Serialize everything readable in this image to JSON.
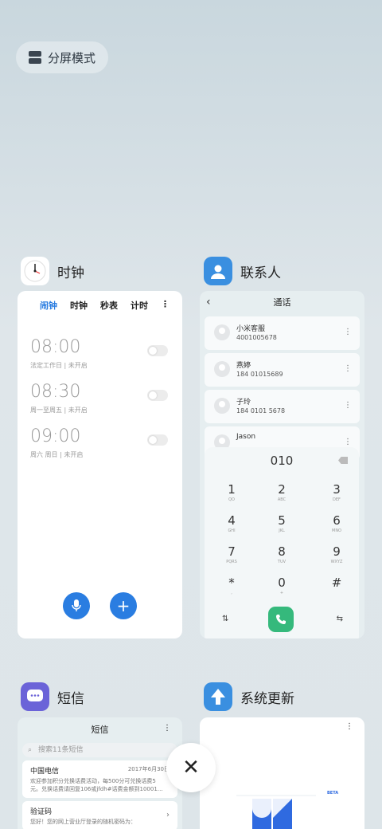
{
  "split_screen": {
    "label": "分屏模式"
  },
  "apps": {
    "clock": {
      "name": "时钟",
      "tabs": [
        "闹钟",
        "时钟",
        "秒表",
        "计时"
      ],
      "alarms": [
        {
          "time": "08:00",
          "desc": "法定工作日 | 未开启"
        },
        {
          "time": "08:30",
          "desc": "周一至周五 | 未开启"
        },
        {
          "time": "09:00",
          "desc": "周六 周日 | 未开启"
        }
      ]
    },
    "contacts": {
      "name": "联系人",
      "title": "通话",
      "list": [
        {
          "name": "小米客服",
          "number": "4001005678"
        },
        {
          "name": "燕婷",
          "number": "184 01015689"
        },
        {
          "name": "子玲",
          "number": "184 0101 5678"
        },
        {
          "name": "Jason",
          "number": ""
        }
      ],
      "dialed": "010",
      "keys": [
        {
          "d": "1",
          "l": "QO"
        },
        {
          "d": "2",
          "l": "ABC"
        },
        {
          "d": "3",
          "l": "DEF"
        },
        {
          "d": "4",
          "l": "GHI"
        },
        {
          "d": "5",
          "l": "JKL"
        },
        {
          "d": "6",
          "l": "MNO"
        },
        {
          "d": "7",
          "l": "PQRS"
        },
        {
          "d": "8",
          "l": "TUV"
        },
        {
          "d": "9",
          "l": "WXYZ"
        },
        {
          "d": "*",
          "l": ","
        },
        {
          "d": "0",
          "l": "+"
        },
        {
          "d": "#",
          "l": ""
        }
      ]
    },
    "sms": {
      "name": "短信",
      "title": "短信",
      "search_placeholder": "搜索11条短信",
      "messages": [
        {
          "sender": "中国电信",
          "date": "2017年6月30日",
          "preview": "欢迎参加积分兑换话费活动，每500分可兑换话费5元。兑换话费请回复106或jfdh#话费金额到10001…"
        },
        {
          "sender": "验证码",
          "date": "",
          "preview": "您好！您的网上营业厅登录的随机密码为："
        }
      ]
    },
    "update": {
      "name": "系统更新",
      "badge": "BETA"
    }
  },
  "colors": {
    "accent": "#2a7de1",
    "call": "#35b97c"
  }
}
